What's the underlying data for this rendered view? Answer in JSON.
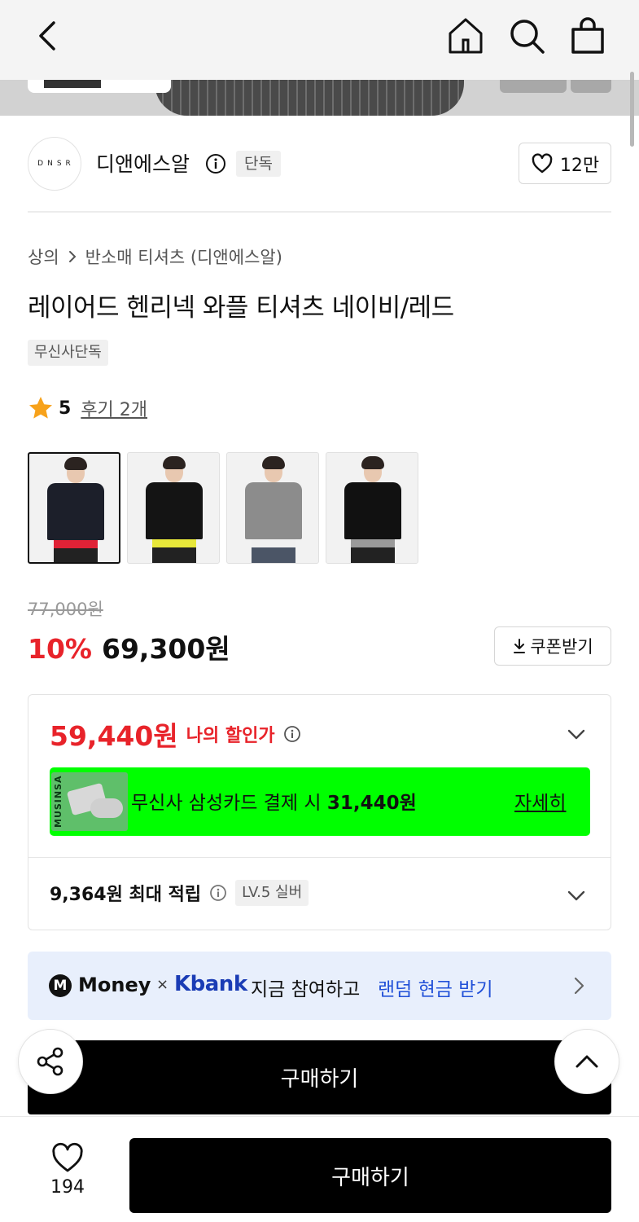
{
  "nav": {
    "back_icon": "chevron-left-icon",
    "home_icon": "home-icon",
    "search_icon": "search-icon",
    "cart_icon": "shopping-bag-icon"
  },
  "brand": {
    "logo_text": "DNSR",
    "name": "디앤에스알",
    "tag": "단독",
    "like_count": "12만"
  },
  "breadcrumb": {
    "category": "상의",
    "subcategory": "반소매 티셔츠 (디앤에스알)"
  },
  "product": {
    "title": "레이어드 헨리넥 와플 티셔츠 네이비/레드",
    "exclusive_tag": "무신사단독",
    "rating": "5",
    "review_label": "후기 2개"
  },
  "thumbnails": [
    {
      "label": "navy/red",
      "shirt": "#1c1f2a",
      "hem": "#e02236",
      "active": true
    },
    {
      "label": "black/yellow",
      "shirt": "#141414",
      "hem": "#e8e83a",
      "active": false
    },
    {
      "label": "grey/white",
      "shirt": "#8c8c8c",
      "hem": "#f0f0f0",
      "active": false
    },
    {
      "label": "black/grey",
      "shirt": "#111111",
      "hem": "#9a9a9a",
      "active": false
    }
  ],
  "price": {
    "original": "77,000원",
    "discount": "10%",
    "sale": "69,300원",
    "coupon_label": "쿠폰받기"
  },
  "benefits": {
    "my_price": "59,440원",
    "my_price_label": "나의 할인가",
    "card_brand": "MUSINSA",
    "card_text_prefix": "무신사 삼성카드 결제 시 ",
    "card_amount": "31,440원",
    "card_detail": "자세히",
    "points": "9,364원 최대 적립",
    "level": "LV.5 실버"
  },
  "promo": {
    "m_logo": "M",
    "money": "Money",
    "x": "×",
    "kbank": "Kbank",
    "message": "지금 참여하고",
    "highlight": "랜덤 현금 받기"
  },
  "actions": {
    "buy_inline": "구매하기",
    "buy_bottom": "구매하기",
    "wish_count": "194"
  },
  "colors": {
    "accent_red": "#e8232a",
    "card_banner": "#00ff00",
    "kbank_blue": "#1a3cb5",
    "link_blue": "#2150d8"
  }
}
